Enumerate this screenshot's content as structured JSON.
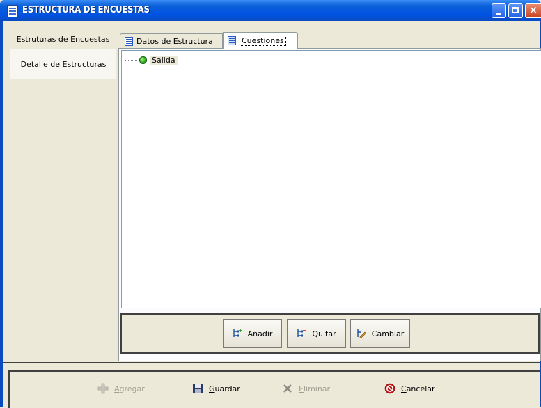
{
  "window": {
    "title": "ESTRUCTURA DE ENCUESTAS"
  },
  "sidebar": {
    "items": [
      {
        "label": "Estruturas de Encuestas"
      },
      {
        "label": "Detalle de Estructuras",
        "selected": true
      }
    ]
  },
  "tabs": [
    {
      "label": "Datos de Estructura",
      "icon": "document-icon"
    },
    {
      "label": "Cuestiones",
      "icon": "tree-list-icon",
      "active": true
    }
  ],
  "tree": {
    "nodes": [
      {
        "label": "Salida",
        "icon": "green-dot-icon"
      }
    ]
  },
  "toolbar": {
    "add_first": "A",
    "add_rest": "ñadir",
    "remove_first": "Q",
    "remove_rest": "uitar",
    "change_first": "C",
    "change_rest": "ambiar"
  },
  "actions": {
    "agregar_first": "A",
    "agregar_rest": "gregar",
    "guardar_first": "G",
    "guardar_rest": "uardar",
    "eliminar_first": "E",
    "eliminar_rest": "liminar",
    "cancelar_first": "C",
    "cancelar_rest": "ancelar"
  },
  "colors": {
    "titlebar": "#0054e3",
    "window_bg": "#ece9d8",
    "disabled_text": "#a19f92",
    "node_green": "#1a9a10"
  }
}
